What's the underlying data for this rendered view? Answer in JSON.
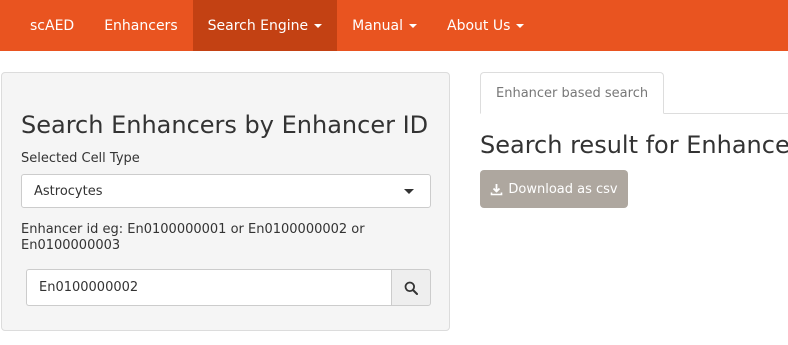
{
  "colors": {
    "navbar_bg": "#e95420",
    "navbar_active_bg": "#c34113",
    "download_button_bg": "#aea79f"
  },
  "navbar": {
    "items": [
      {
        "label": "scAED",
        "dropdown": false,
        "active": false
      },
      {
        "label": "Enhancers",
        "dropdown": false,
        "active": false
      },
      {
        "label": "Search Engine",
        "dropdown": true,
        "active": true
      },
      {
        "label": "Manual",
        "dropdown": true,
        "active": false
      },
      {
        "label": "About Us",
        "dropdown": true,
        "active": false
      }
    ]
  },
  "search_panel": {
    "title": "Search Enhancers by Enhancer ID",
    "cell_type_label": "Selected Cell Type",
    "cell_type_value": "Astrocytes",
    "hint": "Enhancer id eg: En0100000001 or En0100000002 or En0100000003",
    "search_value": "En0100000002",
    "search_icon": "search-icon"
  },
  "results": {
    "tab_label": "Enhancer based search",
    "title": "Search result for Enhancer",
    "download_label": "Download as csv",
    "download_icon": "download-icon"
  }
}
